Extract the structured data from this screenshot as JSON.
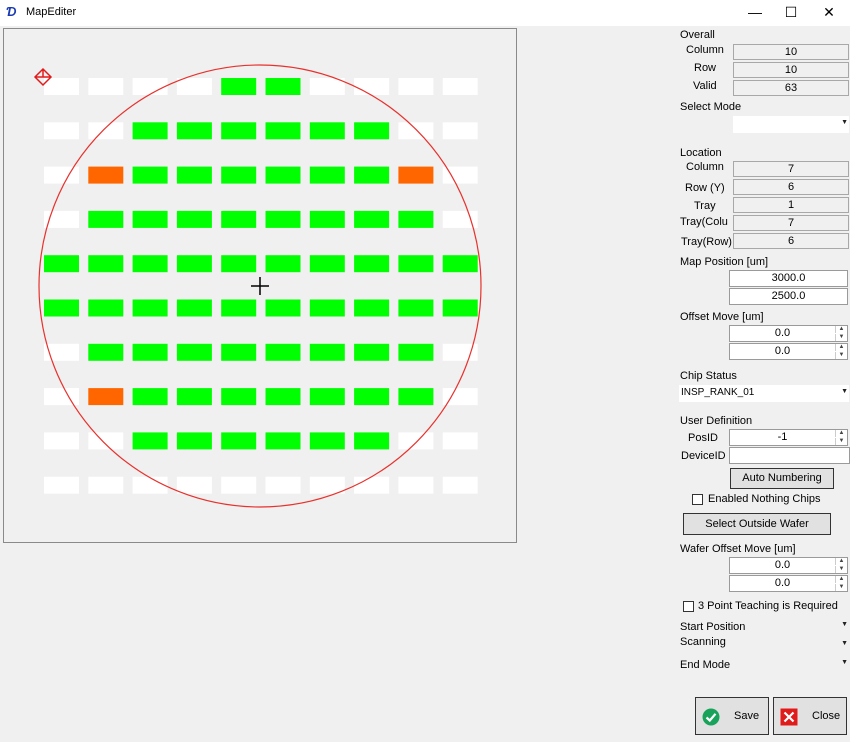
{
  "window": {
    "title": "MapEditer",
    "minimize": "—",
    "maximize": "☐",
    "close": "✕"
  },
  "map": {
    "columns": 10,
    "rows": 10,
    "colors": {
      "valid": "#00ff00",
      "invalid": "#ffffff",
      "selected": "#ff6600",
      "wafer": "#e8312d"
    },
    "grid": [
      "0000110000",
      "0011111100",
      "0211111120",
      "0111111110",
      "1111111111",
      "1111111111",
      "0111111110",
      "0211111110",
      "0011111100",
      "0000000000"
    ]
  },
  "overall": {
    "label": "Overall",
    "column_label": "Column",
    "column": "10",
    "row_label": "Row",
    "row": "10",
    "valid_label": "Valid",
    "valid": "63"
  },
  "select_mode": {
    "label": "Select Mode",
    "value": ""
  },
  "location": {
    "label": "Location",
    "column_label": "Column",
    "column": "7",
    "row_label": "Row (Y)",
    "row": "6",
    "tray_label": "Tray",
    "tray": "1",
    "tray_col_label": "Tray(Colu",
    "tray_col": "7",
    "tray_row_label": "Tray(Row)",
    "tray_row": "6"
  },
  "map_position": {
    "label": "Map Position [um]",
    "x": "3000.0",
    "y": "2500.0"
  },
  "offset_move": {
    "label": "Offset Move [um]",
    "x": "0.0",
    "y": "0.0"
  },
  "chip_status": {
    "label": "Chip Status",
    "value": "INSP_RANK_01"
  },
  "user_definition": {
    "label": "User Definition",
    "pos_id_label": "PosID",
    "pos_id": "-1",
    "device_id_label": "DeviceID",
    "device_id": ""
  },
  "auto_numbering": "Auto Numbering",
  "enabled_nothing_chips": "Enabled Nothing Chips",
  "select_outside_wafer": "Select Outside Wafer",
  "wafer_offset_move": {
    "label": "Wafer Offset Move [um]",
    "x": "0.0",
    "y": "0.0"
  },
  "three_point_teaching": "3 Point Teaching is Required",
  "start_position": {
    "label": "Start Position",
    "value": ""
  },
  "scanning": {
    "label": "Scanning",
    "value": ""
  },
  "end_mode": {
    "label": "End Mode",
    "value": ""
  },
  "save_label": "Save",
  "close_label": "Close",
  "icons": {
    "app": "app-logo-icon",
    "save": "check-circle-icon",
    "close": "red-x-icon",
    "origin": "origin-marker-icon",
    "crosshair": "crosshair-icon"
  }
}
